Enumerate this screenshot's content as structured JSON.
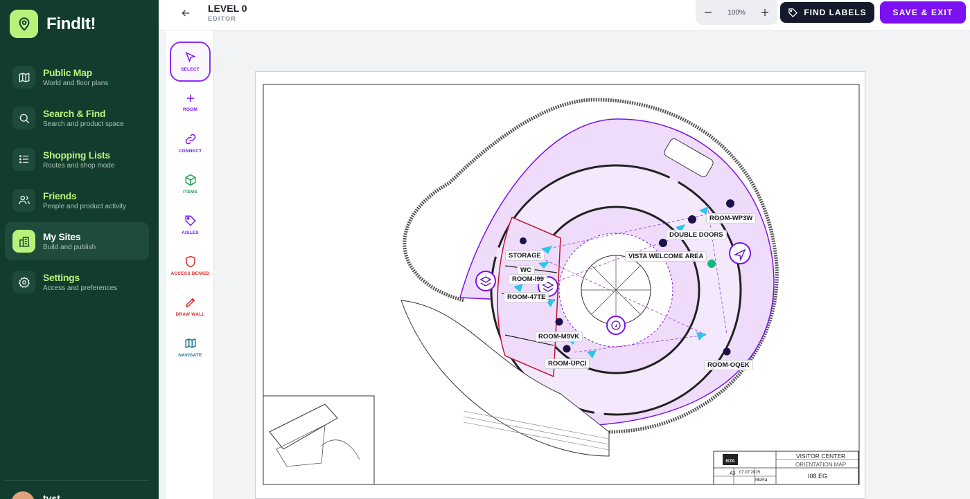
{
  "app": {
    "name": "FindIt!"
  },
  "sidebar": {
    "items": [
      {
        "title": "Public Map",
        "subtitle": "World and floor plans",
        "icon": "map-icon"
      },
      {
        "title": "Search & Find",
        "subtitle": "Search and product space",
        "icon": "search-icon"
      },
      {
        "title": "Shopping Lists",
        "subtitle": "Routes and shop mode",
        "icon": "list-icon"
      },
      {
        "title": "Friends",
        "subtitle": "People and product activity",
        "icon": "users-icon"
      },
      {
        "title": "My Sites",
        "subtitle": "Build and publish",
        "icon": "building-icon",
        "active": true
      },
      {
        "title": "Settings",
        "subtitle": "Access and preferences",
        "icon": "gear-icon"
      }
    ],
    "user": {
      "name": "tvst"
    }
  },
  "header": {
    "title": "LEVEL 0",
    "subtitle": "EDITOR",
    "zoom": "100%",
    "find_labels": "FIND LABELS",
    "save_exit": "SAVE & EXIT"
  },
  "tools": [
    {
      "label": "SELECT",
      "icon": "cursor-icon",
      "color": "#7b10f2",
      "active": true
    },
    {
      "label": "ROOM",
      "icon": "plus-icon",
      "color": "#7b10f2"
    },
    {
      "label": "CONNECT",
      "icon": "link-icon",
      "color": "#7b10f2"
    },
    {
      "label": "ITEMS",
      "icon": "cube-icon",
      "color": "#16a34a"
    },
    {
      "label": "AISLES",
      "icon": "tag-icon",
      "color": "#7b10f2"
    },
    {
      "label": "ACCESS DENIED",
      "icon": "shield-icon",
      "color": "#dc2626"
    },
    {
      "label": "DRAW WALL",
      "icon": "pen-icon",
      "color": "#dc2626"
    },
    {
      "label": "NAVIGATE",
      "icon": "map-icon",
      "color": "#0e7490"
    }
  ],
  "plan": {
    "rooms": [
      {
        "label": "ROOM-WP3W"
      },
      {
        "label": "DOUBLE DOORS"
      },
      {
        "label": "VISTA WELCOME AREA"
      },
      {
        "label": "STORAGE"
      },
      {
        "label": "WC"
      },
      {
        "label": "ROOM-I99"
      },
      {
        "label": "ROOM-47TE"
      },
      {
        "label": "ROOM-M9VK"
      },
      {
        "label": "ROOM-UPCI"
      },
      {
        "label": "ROOM-OQEK"
      }
    ],
    "title_block": {
      "logo": "ISTA",
      "building": "VISITOR CENTER",
      "plan_name": "ORIENTATION MAP",
      "drawing_no": "I08.EG",
      "paper": "A3",
      "date": "07.07.2025",
      "drawn_by": "MoRa"
    },
    "colors": {
      "room_fill": "#efdcfb",
      "room_stroke": "#7b10f2",
      "marker": "#1c1248",
      "connector": "#2ec4e8"
    }
  }
}
